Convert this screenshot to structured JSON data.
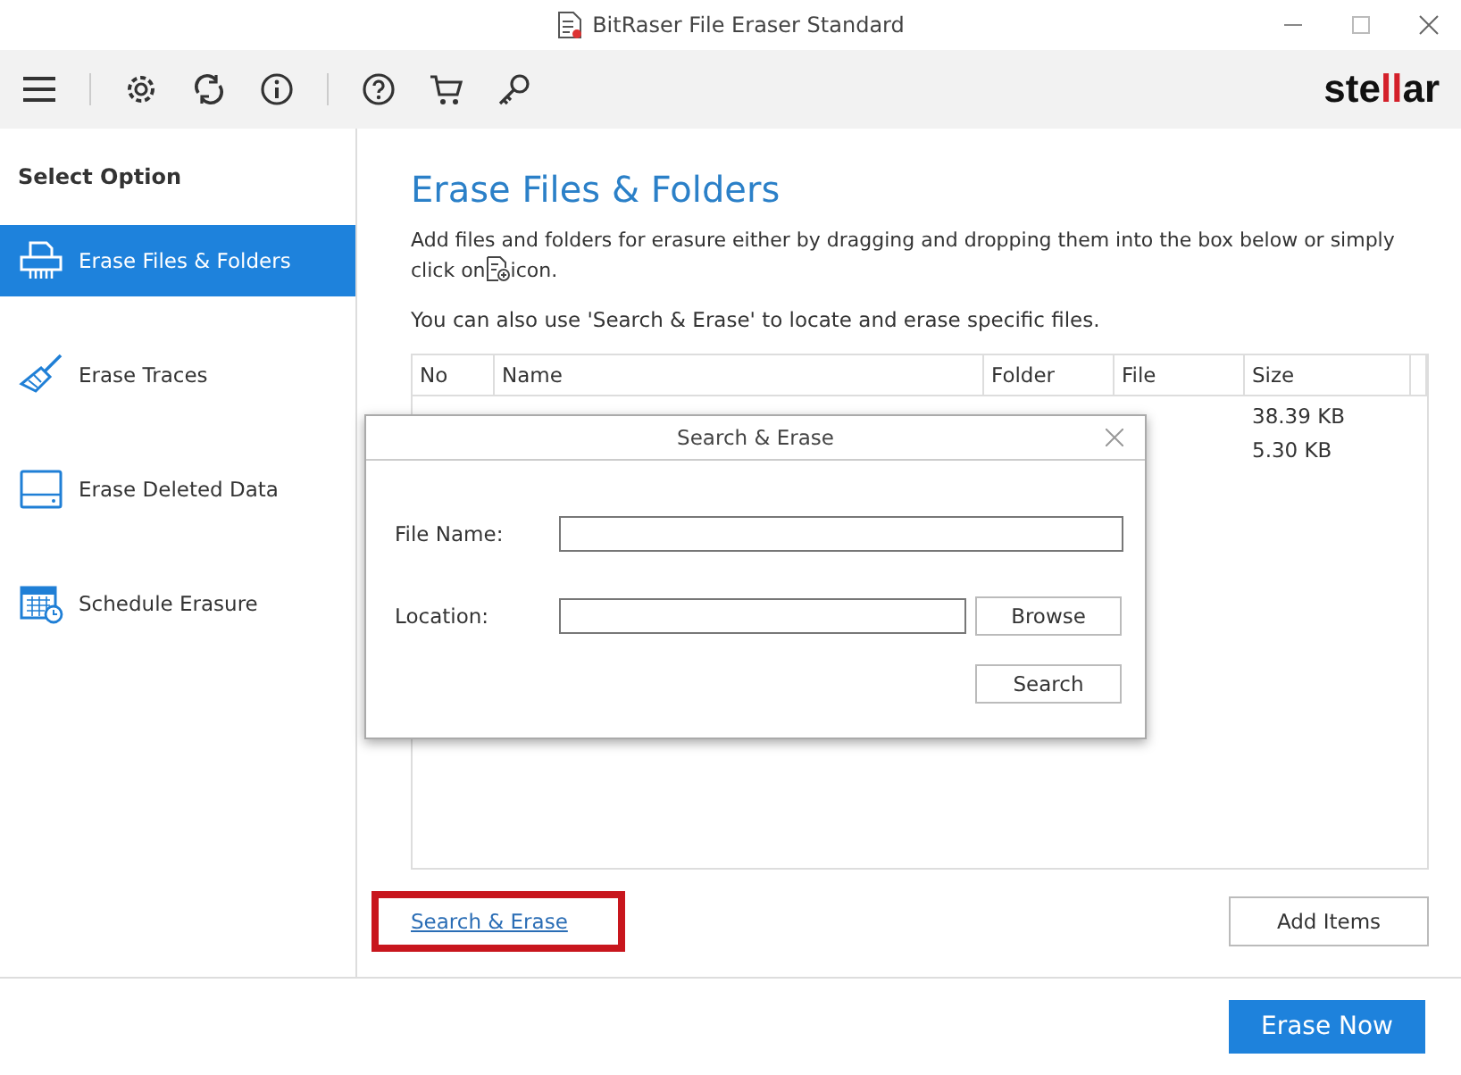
{
  "window": {
    "title": "BitRaser File Eraser Standard"
  },
  "toolbar": {
    "logo_parts": [
      "ste",
      "ll",
      "ar"
    ]
  },
  "sidebar": {
    "heading": "Select Option",
    "items": [
      {
        "label": "Erase Files & Folders",
        "kind": "shredder",
        "selected": true
      },
      {
        "label": "Erase Traces",
        "kind": "broom",
        "selected": false
      },
      {
        "label": "Erase Deleted Data",
        "kind": "drive",
        "selected": false
      },
      {
        "label": "Schedule Erasure",
        "kind": "calendar",
        "selected": false
      }
    ]
  },
  "content": {
    "title": "Erase Files & Folders",
    "intro_line1": "Add files and folders for erasure either by dragging and dropping them into the box below or simply",
    "intro_before": "click on",
    "intro_after": "icon.",
    "hint": "You can also use 'Search & Erase' to locate and erase specific files.",
    "table": {
      "columns": [
        "No",
        "Name",
        "Folder",
        "File",
        "Size"
      ],
      "rows": [
        {
          "size": "38.39 KB"
        },
        {
          "size": "5.30 KB"
        }
      ]
    },
    "link": "Search & Erase",
    "add_button": "Add Items"
  },
  "dialog": {
    "title": "Search & Erase",
    "file_name_label": "File Name:",
    "location_label": "Location:",
    "browse_button": "Browse",
    "search_button": "Search"
  },
  "footer": {
    "erase_button": "Erase Now"
  }
}
